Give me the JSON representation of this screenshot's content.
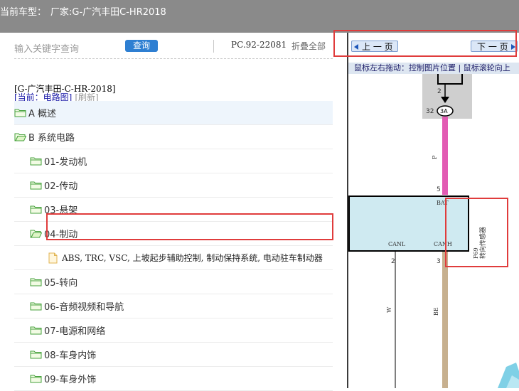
{
  "window": {
    "title_label": "当前车型：",
    "title_value": "厂家:G-广汽丰田C-HR2018"
  },
  "search": {
    "placeholder": "输入关键字查询",
    "button_label": "查询",
    "pc_number": "PC.92-22081",
    "collapse_label": "折叠全部"
  },
  "tree": {
    "model": "[G-广汽丰田-C-HR-2018]",
    "current": "[当前：电路图]",
    "refresh": "[刷新]",
    "items": [
      {
        "label": "A 概述",
        "level": 0,
        "type": "folder",
        "open": false,
        "selected": true
      },
      {
        "label": "B 系统电路",
        "level": 0,
        "type": "folder",
        "open": true,
        "selected": false
      },
      {
        "label": "01-发动机",
        "level": 1,
        "type": "folder",
        "open": false,
        "selected": false
      },
      {
        "label": "02-传动",
        "level": 1,
        "type": "folder",
        "open": false,
        "selected": false
      },
      {
        "label": "03-悬架",
        "level": 1,
        "type": "folder",
        "open": false,
        "selected": false
      },
      {
        "label": "04-制动",
        "level": 1,
        "type": "folder",
        "open": true,
        "selected": false
      },
      {
        "label": "ABS, TRC, VSC, 上坡起步辅助控制, 制动保持系统, 电动驻车制动器",
        "level": 2,
        "type": "file",
        "open": false,
        "selected": false
      },
      {
        "label": "05-转向",
        "level": 1,
        "type": "folder",
        "open": false,
        "selected": false
      },
      {
        "label": "06-音频视频和导航",
        "level": 1,
        "type": "folder",
        "open": false,
        "selected": false
      },
      {
        "label": "07-电源和网络",
        "level": 1,
        "type": "folder",
        "open": false,
        "selected": false
      },
      {
        "label": "08-车身内饰",
        "level": 1,
        "type": "folder",
        "open": false,
        "selected": false
      },
      {
        "label": "09-车身外饰",
        "level": 1,
        "type": "folder",
        "open": false,
        "selected": false
      }
    ]
  },
  "viewer": {
    "prev_label": "上 一 页",
    "next_label": "下 一 页",
    "hint": "鼠标左右拖动：控制图片位置 | 鼠标滚轮向上",
    "diagram": {
      "pin_top": "2",
      "pin_32": "32",
      "connector": "3A",
      "wire_p": "P",
      "pin_5": "5",
      "label_bat": "BAT",
      "label_canl": "CANL",
      "label_canh": "CANH",
      "pin_2": "2",
      "pin_3": "3",
      "wire_w": "W",
      "wire_be": "BE",
      "component_code": "F69",
      "component_name": "转向传感器"
    }
  },
  "colors": {
    "top_bar": "#8a8a8a",
    "query_button": "#2e7fd2",
    "highlight_border": "#e03c3c",
    "wire_pink": "#e25bb3",
    "wire_tan": "#c7b08f",
    "box_fill": "#cfeaf1"
  }
}
